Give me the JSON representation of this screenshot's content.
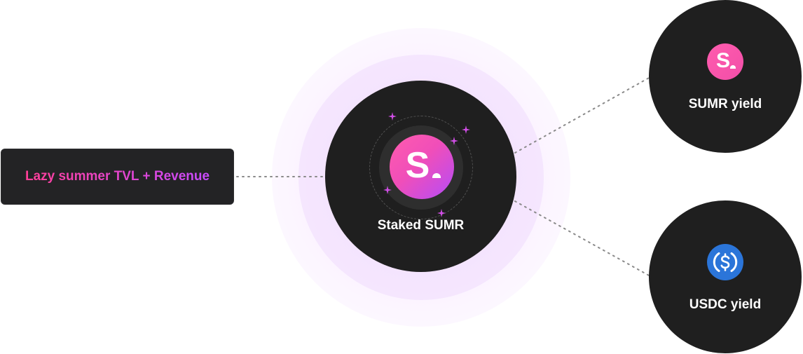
{
  "source": {
    "label": "Lazy summer TVL + Revenue"
  },
  "center": {
    "label": "Staked SUMR",
    "logo_letter": "S",
    "icon": "sumr-logo-icon"
  },
  "yields": [
    {
      "label": "SUMR yield",
      "icon": "sumr-logo-icon",
      "logo_letter": "S"
    },
    {
      "label": "USDC yield",
      "icon": "usdc-logo-icon"
    }
  ],
  "colors": {
    "background": "#ffffff",
    "node_dark": "#1f1f1f",
    "box_dark": "#232325",
    "gradient_pink": "#ff3f98",
    "gradient_purple": "#c84bff",
    "usdc_blue": "#2b75d9",
    "connector": "#8a8a8a"
  }
}
